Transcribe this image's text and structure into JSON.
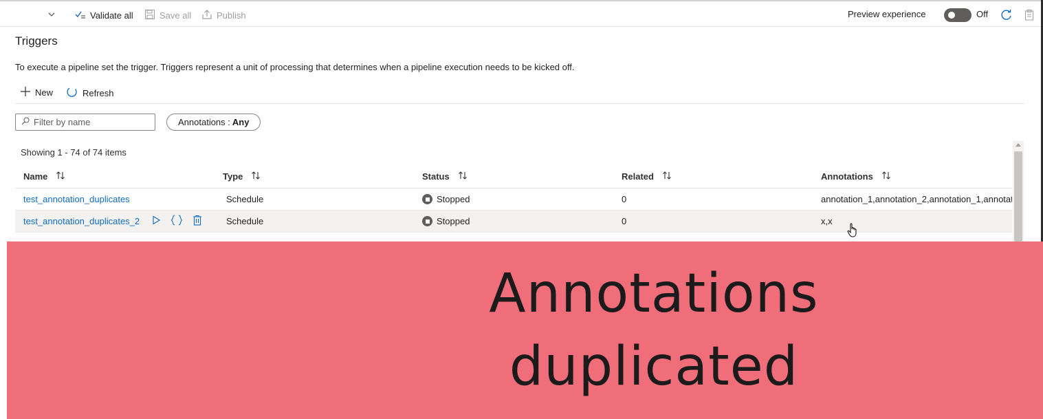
{
  "toolbar": {
    "validate_all": "Validate all",
    "save_all": "Save all",
    "publish": "Publish",
    "preview_label": "Preview experience",
    "toggle_state": "Off",
    "preview_enabled": false
  },
  "page": {
    "title": "Triggers",
    "description": "To execute a pipeline set the trigger. Triggers represent a unit of processing that determines when a pipeline execution needs to be kicked off."
  },
  "commands": {
    "new": "New",
    "refresh": "Refresh"
  },
  "filters": {
    "search_placeholder": "Filter by name",
    "annotations_label": "Annotations :",
    "annotations_value": "Any"
  },
  "grid": {
    "summary": "Showing 1 - 74 of 74 items",
    "columns": [
      "Name",
      "Type",
      "Status",
      "Related",
      "Annotations"
    ],
    "rows": [
      {
        "name": "test_annotation_duplicates",
        "type": "Schedule",
        "status": "Stopped",
        "related": "0",
        "annotations": "annotation_1,annotation_2,annotation_1,annotat"
      },
      {
        "name": "test_annotation_duplicates_2",
        "type": "Schedule",
        "status": "Stopped",
        "related": "0",
        "annotations": "x,x"
      }
    ]
  },
  "banner": {
    "line1": "Annotations",
    "line2": "duplicated",
    "color": "#f06d7a"
  },
  "colors": {
    "link": "#0f6cbd",
    "status_stopped": "#605e5c"
  }
}
